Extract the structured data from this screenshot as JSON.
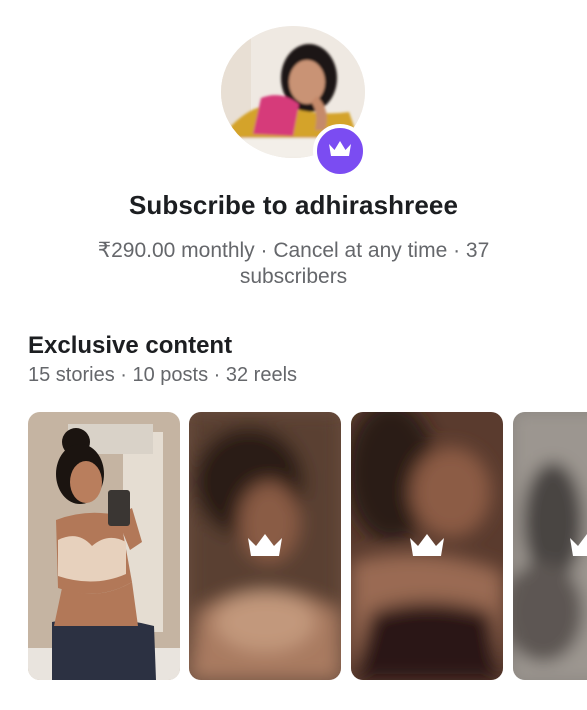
{
  "profile": {
    "avatar_icon": "crown-icon",
    "badge_color": "#7b4cf2"
  },
  "subscribe": {
    "title": "Subscribe to adhirashreee",
    "details": "₹290.00 monthly · Cancel at any time · 37 subscribers"
  },
  "exclusive": {
    "heading": "Exclusive content",
    "counts": "15 stories · 10 posts · 32 reels"
  },
  "colors": {
    "text_primary": "#1c1e21",
    "text_secondary": "#65676b",
    "accent": "#7b4cf2"
  },
  "cards": [
    {
      "type": "preview",
      "locked": false
    },
    {
      "type": "blurred",
      "locked": true,
      "icon": "crown-icon"
    },
    {
      "type": "blurred",
      "locked": true,
      "icon": "crown-icon"
    },
    {
      "type": "blurred",
      "locked": true,
      "icon": "crown-icon"
    }
  ]
}
